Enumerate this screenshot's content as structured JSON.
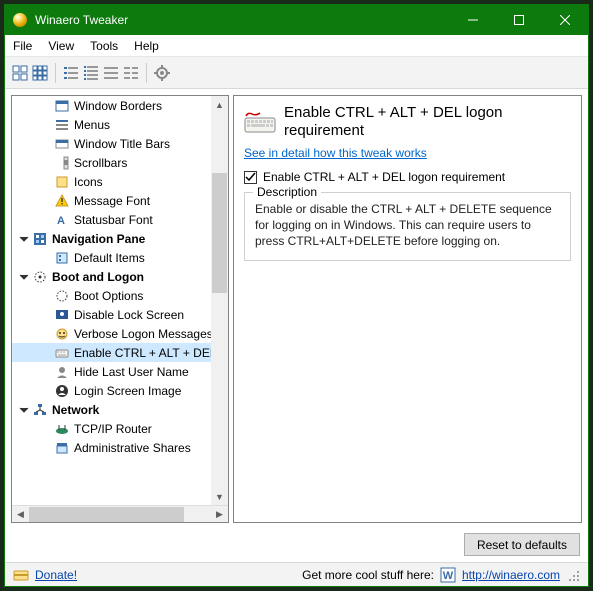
{
  "titlebar": {
    "title": "Winaero Tweaker"
  },
  "menubar": {
    "file": "File",
    "view": "View",
    "tools": "Tools",
    "help": "Help"
  },
  "tree": {
    "items_top": [
      {
        "label": "Window Borders",
        "icon": "window"
      },
      {
        "label": "Menus",
        "icon": "menus"
      },
      {
        "label": "Window Title Bars",
        "icon": "titlebars"
      },
      {
        "label": "Scrollbars",
        "icon": "scrollbars"
      },
      {
        "label": "Icons",
        "icon": "icons"
      },
      {
        "label": "Message Font",
        "icon": "warn"
      },
      {
        "label": "Statusbar Font",
        "icon": "font"
      }
    ],
    "cat_nav": {
      "label": "Navigation Pane"
    },
    "nav_items": [
      {
        "label": "Default Items",
        "icon": "default"
      }
    ],
    "cat_boot": {
      "label": "Boot and Logon"
    },
    "boot_items": [
      {
        "label": "Boot Options",
        "icon": "boot"
      },
      {
        "label": "Disable Lock Screen",
        "icon": "lock"
      },
      {
        "label": "Verbose Logon Messages",
        "icon": "verb"
      },
      {
        "label": "Enable CTRL + ALT + DEL",
        "icon": "keyboard",
        "selected": true
      },
      {
        "label": "Hide Last User Name",
        "icon": "user"
      },
      {
        "label": "Login Screen Image",
        "icon": "avatar"
      }
    ],
    "cat_net": {
      "label": "Network"
    },
    "net_items": [
      {
        "label": "TCP/IP Router",
        "icon": "router"
      },
      {
        "label": "Administrative Shares",
        "icon": "admin"
      }
    ]
  },
  "detail": {
    "title": "Enable CTRL + ALT + DEL logon requirement",
    "link": "See in detail how this tweak works",
    "checkbox": "Enable CTRL + ALT + DEL logon requirement",
    "legend": "Description",
    "desc": "Enable or disable the CTRL + ALT + DELETE sequence for logging on in Windows. This can require users to press CTRL+ALT+DELETE before logging on."
  },
  "buttons": {
    "reset": "Reset to defaults"
  },
  "statusbar": {
    "donate": "Donate!",
    "more": "Get more cool stuff here:",
    "url": "http://winaero.com"
  }
}
